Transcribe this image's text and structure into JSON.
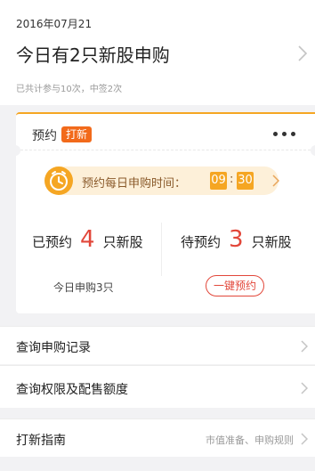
{
  "header": {
    "date": "2016年07月21",
    "headline": "今日有2只新股申购",
    "stats": "已共计参与10次，中签2次"
  },
  "reserve_card": {
    "title": "预约",
    "badge": "打新",
    "time_prompt": "预约每日申购时间：",
    "hour": "09",
    "minute": "30",
    "separator": ":",
    "reserved": {
      "prefix": "已预约",
      "count": "4",
      "suffix": "只新股"
    },
    "pending": {
      "prefix": "待预约",
      "count": "3",
      "suffix": "只新股"
    },
    "today_count": "今日申购3只",
    "one_key_button": "一键预约"
  },
  "menu": [
    {
      "label": "查询申购记录",
      "hint": ""
    },
    {
      "label": "查询权限及配售额度",
      "hint": ""
    },
    {
      "label": "打新指南",
      "hint": "市值准备、申购规则"
    }
  ],
  "icons": {
    "clock": "alarm-clock-icon",
    "chevron": "chevron-right-icon",
    "more": "more-dots-icon"
  },
  "colors": {
    "accent_orange": "#f5a623",
    "badge_orange": "#f26a1b",
    "highlight_red": "#e2473a",
    "pill_background": "#fdf0d9"
  }
}
